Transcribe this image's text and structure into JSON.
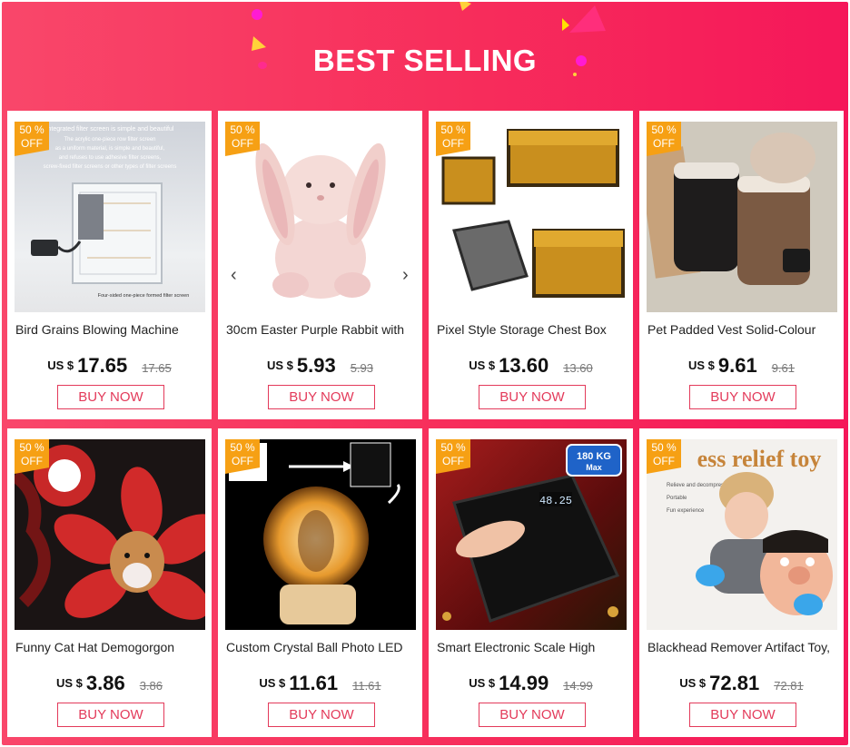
{
  "header": {
    "title": "BEST SELLING"
  },
  "badge": {
    "percent": "50 %",
    "off": "OFF"
  },
  "currency": "US $",
  "buy_label": "BUY NOW",
  "products": [
    {
      "name": "Bird Grains Blowing Machine",
      "price": "17.65",
      "old_price": "17.65",
      "image_text": [
        "Integrated filter screen is simple and beautiful",
        "The acrylic one-piece row filter screen",
        "as a uniform material, is simple and beautiful,",
        "and refuses to use adhesive filter screens,",
        "screw-fixed filter screens or other types of filter screens",
        "Four-sided one-piece formed filter screen"
      ]
    },
    {
      "name": "30cm Easter Purple Rabbit with",
      "price": "5.93",
      "old_price": "5.93"
    },
    {
      "name": "Pixel Style Storage Chest Box",
      "price": "13.60",
      "old_price": "13.60"
    },
    {
      "name": "Pet Padded Vest Solid-Colour",
      "price": "9.61",
      "old_price": "9.61"
    },
    {
      "name": "Funny Cat Hat Demogorgon",
      "price": "3.86",
      "old_price": "3.86"
    },
    {
      "name": "Custom Crystal Ball Photo LED",
      "price": "11.61",
      "old_price": "11.61"
    },
    {
      "name": "Smart Electronic Scale High",
      "price": "14.99",
      "old_price": "14.99",
      "image_text": {
        "capacity": "180 KG",
        "max": "Max",
        "display": "48.25"
      }
    },
    {
      "name": "Blackhead Remover Artifact Toy,",
      "price": "72.81",
      "old_price": "72.81",
      "image_text": {
        "headline": "ess relief toy",
        "lines": [
          "Relieve and decompress",
          "Portable",
          "Fun experience"
        ]
      }
    }
  ],
  "colors": {
    "banner": "#f72d5b",
    "badge": "#f6a014",
    "button_border": "#e33a5a"
  }
}
